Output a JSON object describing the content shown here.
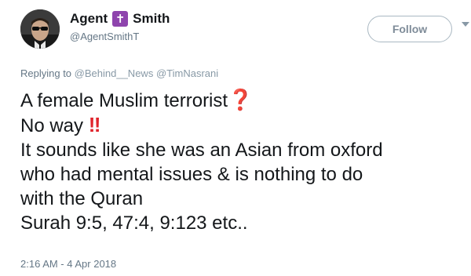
{
  "author": {
    "name": "Agent",
    "name_suffix": "Smith",
    "badge_glyph": "✝",
    "handle": "@AgentSmithT",
    "avatar_icon": "agent-smith-avatar"
  },
  "follow_button": {
    "label": "Follow"
  },
  "reply": {
    "prefix": "Replying to",
    "mentions": [
      "@Behind__News",
      "@TimNasrani"
    ]
  },
  "tweet": {
    "line1": "A female Muslim terrorist",
    "line1_emoji": "❓",
    "line2": "No way",
    "line2_emoji": "‼",
    "line3": "It sounds like she was an Asian from oxford",
    "line4": "who had mental issues & is nothing to do",
    "line5": "with the Quran",
    "line6": "Surah 9:5, 47:4, 9:123 etc.."
  },
  "timestamp": "2:16 AM - 4 Apr 2018",
  "colors": {
    "text": "#14171a",
    "secondary": "#657786",
    "badge": "#8e44ad",
    "emoji_red": "#e0242c"
  }
}
